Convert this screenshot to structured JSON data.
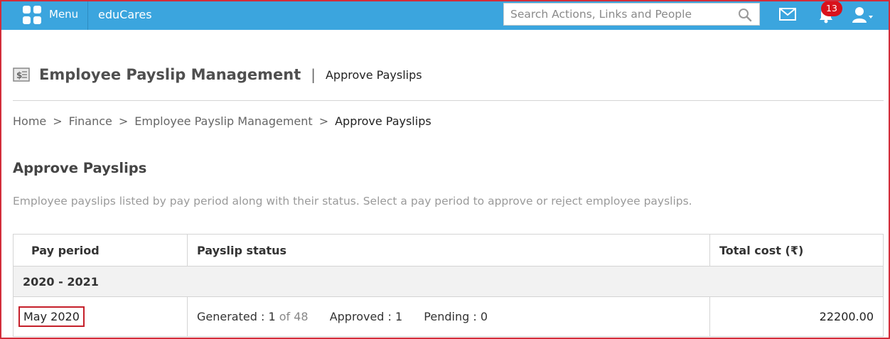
{
  "topbar": {
    "menu_label": "Menu",
    "app_name": "eduCares",
    "search_placeholder": "Search Actions, Links and People",
    "notification_count": "13"
  },
  "header": {
    "title": "Employee Payslip Management",
    "separator": "|",
    "subtitle": "Approve Payslips"
  },
  "breadcrumb": {
    "items": [
      "Home",
      "Finance",
      "Employee Payslip Management"
    ],
    "separator": ">",
    "current": "Approve Payslips"
  },
  "section": {
    "title": "Approve Payslips",
    "description": "Employee payslips listed by pay period along with their status. Select a pay period to approve or reject employee payslips."
  },
  "table": {
    "headers": [
      "Pay period",
      "Payslip status",
      "Total cost (₹)"
    ],
    "group_label": "2020 - 2021",
    "rows": [
      {
        "period": "May 2020",
        "generated_label": "Generated :",
        "generated_value": "1",
        "generated_of": "of 48",
        "approved_label": "Approved :",
        "approved_value": "1",
        "pending_label": "Pending :",
        "pending_value": "0",
        "total_cost": "22200.00"
      }
    ]
  },
  "colors": {
    "topbar": "#3ba5de",
    "highlight_border": "#d22d3a",
    "badge": "#d9121c"
  }
}
